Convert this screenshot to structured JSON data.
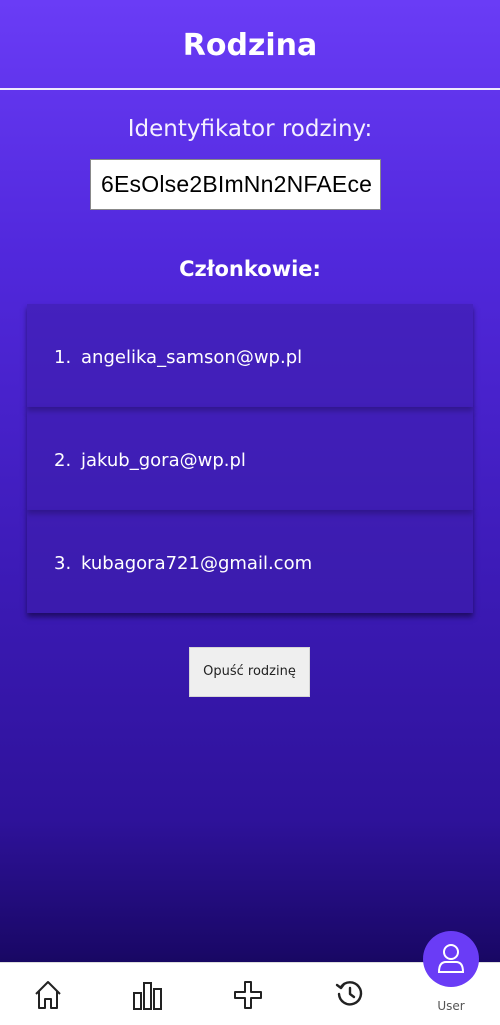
{
  "header": {
    "title": "Rodzina"
  },
  "family": {
    "id_label": "Identyfikator rodziny:",
    "id_value": "6EsOlse2BImNn2NFAEce"
  },
  "members": {
    "title": "Członkowie:",
    "items": [
      {
        "num": "1.",
        "email": "angelika_samson@wp.pl"
      },
      {
        "num": "2.",
        "email": "jakub_gora@wp.pl"
      },
      {
        "num": "3.",
        "email": "kubagora721@gmail.com"
      }
    ]
  },
  "actions": {
    "leave_label": "Opuść rodzinę"
  },
  "nav": {
    "items": [
      {
        "icon": "home-icon"
      },
      {
        "icon": "bar-chart-icon"
      },
      {
        "icon": "plus-icon"
      },
      {
        "icon": "history-icon"
      },
      {
        "icon": "user-icon",
        "label": "User"
      }
    ],
    "accent": "#6a3cf6"
  }
}
